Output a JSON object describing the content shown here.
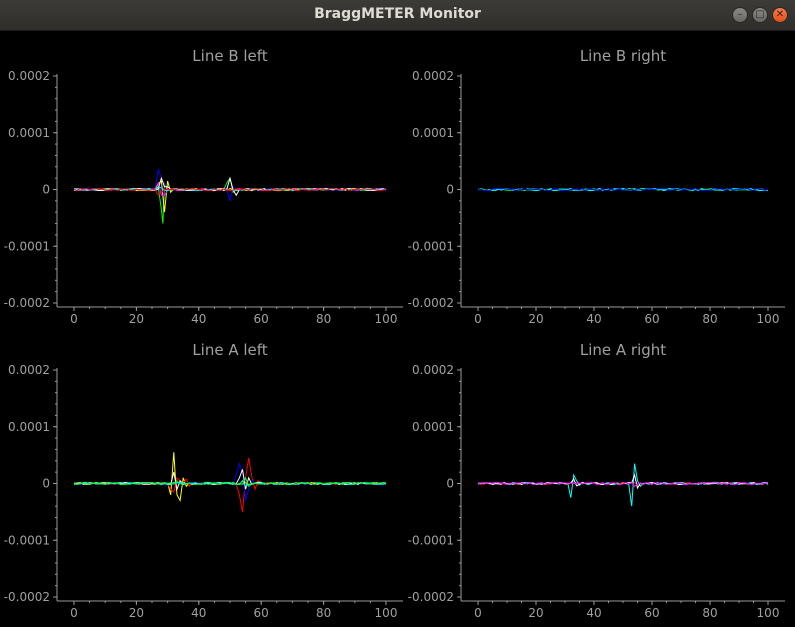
{
  "window": {
    "title": "BraggMETER Monitor",
    "buttons": [
      {
        "name": "minimize-button",
        "glyph": "–"
      },
      {
        "name": "maximize-button",
        "glyph": "□"
      },
      {
        "name": "close-button",
        "glyph": "✕"
      }
    ]
  },
  "colors": {
    "background": "#000000",
    "axis": "#9a9a9a",
    "text": "#a0a0a0"
  },
  "chart_data": [
    {
      "type": "line",
      "title": "Line B left",
      "xlim": [
        0,
        100
      ],
      "ylim": [
        -0.0002,
        0.0002
      ],
      "xticks": [
        "0",
        "20",
        "40",
        "60",
        "80",
        "100"
      ],
      "yticks": [
        "0.0002",
        "0.0001",
        "0",
        "-0.0001",
        "-0.0002"
      ],
      "series": [
        {
          "color": "#00ff00",
          "spikes": [
            [
              27,
              5e-06
            ],
            [
              28,
              -3.5e-05
            ],
            [
              28.5,
              -6e-05
            ],
            [
              29,
              1e-05
            ],
            [
              30,
              0
            ],
            [
              49,
              1.2e-05
            ],
            [
              50,
              2e-05
            ],
            [
              51,
              -5e-06
            ]
          ]
        },
        {
          "color": "#0000ff",
          "spikes": [
            [
              27,
              3.5e-05
            ],
            [
              28,
              2e-05
            ],
            [
              28.5,
              -2e-05
            ],
            [
              29,
              1e-05
            ],
            [
              50,
              -2e-05
            ],
            [
              51,
              5e-06
            ]
          ]
        },
        {
          "color": "#ffff00",
          "spikes": [
            [
              27,
              1e-05
            ],
            [
              28,
              1.5e-05
            ],
            [
              29,
              -4e-05
            ],
            [
              30,
              1.5e-05
            ],
            [
              31,
              -5e-06
            ]
          ]
        },
        {
          "color": "#ff00ff",
          "spikes": [
            [
              27,
              1.2e-05
            ],
            [
              28,
              -1e-05
            ],
            [
              29,
              -1e-05
            ]
          ]
        },
        {
          "color": "#ffffff",
          "spikes": [
            [
              28,
              2e-05
            ],
            [
              29,
              5e-06
            ],
            [
              30,
              5e-06
            ],
            [
              50,
              2e-05
            ],
            [
              52,
              -1e-05
            ],
            [
              53,
              0
            ]
          ]
        },
        {
          "color": "#00ffff",
          "spikes": [
            [
              27,
              4e-06
            ],
            [
              28,
              3e-06
            ]
          ]
        },
        {
          "color": "#ff0000",
          "spikes": [
            [
              27,
              -1e-05
            ],
            [
              28,
              -6e-06
            ]
          ]
        }
      ]
    },
    {
      "type": "line",
      "title": "Line B right",
      "xlim": [
        0,
        100
      ],
      "ylim": [
        -0.0002,
        0.0002
      ],
      "xticks": [
        "0",
        "20",
        "40",
        "60",
        "80",
        "100"
      ],
      "yticks": [
        "0.0002",
        "0.0001",
        "0",
        "-0.0001",
        "-0.0002"
      ],
      "series": [
        {
          "color": "#00ff00",
          "spikes": []
        },
        {
          "color": "#00ffff",
          "spikes": []
        },
        {
          "color": "#0000ff",
          "spikes": []
        }
      ]
    },
    {
      "type": "line",
      "title": "Line A left",
      "xlim": [
        0,
        100
      ],
      "ylim": [
        -0.0002,
        0.0002
      ],
      "xticks": [
        "0",
        "20",
        "40",
        "60",
        "80",
        "100"
      ],
      "yticks": [
        "0.0002",
        "0.0001",
        "0",
        "-0.0001",
        "-0.0002"
      ],
      "series": [
        {
          "color": "#ffff00",
          "spikes": [
            [
              31,
              -2e-05
            ],
            [
              32,
              5.5e-05
            ],
            [
              32.5,
              1e-05
            ],
            [
              33,
              -2e-05
            ],
            [
              34,
              -3e-05
            ],
            [
              35,
              1e-05
            ],
            [
              36,
              -5e-06
            ]
          ]
        },
        {
          "color": "#ff0000",
          "spikes": [
            [
              31,
              -1e-05
            ],
            [
              32,
              -1.5e-05
            ],
            [
              33,
              1e-05
            ],
            [
              34,
              5e-06
            ],
            [
              36,
              8e-06
            ],
            [
              37,
              -5e-06
            ],
            [
              53,
              -2e-05
            ],
            [
              54,
              -5e-05
            ],
            [
              55,
              1e-05
            ],
            [
              56,
              4.5e-05
            ],
            [
              57,
              1.2e-05
            ],
            [
              58,
              -1e-05
            ],
            [
              59,
              5e-06
            ]
          ]
        },
        {
          "color": "#0000ff",
          "spikes": [
            [
              52,
              1.5e-05
            ],
            [
              53,
              3.5e-05
            ],
            [
              54,
              2e-05
            ],
            [
              55,
              -3e-05
            ],
            [
              56,
              -1e-05
            ],
            [
              57,
              5e-06
            ]
          ]
        },
        {
          "color": "#ffffff",
          "spikes": [
            [
              32,
              2e-05
            ],
            [
              33,
              -1e-05
            ],
            [
              34,
              5e-06
            ],
            [
              53,
              1e-05
            ],
            [
              54,
              2.5e-05
            ],
            [
              55,
              -1e-05
            ],
            [
              56,
              1e-05
            ]
          ]
        },
        {
          "color": "#00ffff",
          "spikes": [
            [
              54,
              5e-06
            ],
            [
              55,
              -5e-06
            ]
          ]
        },
        {
          "color": "#00ff00",
          "spikes": [
            [
              33,
              5e-06
            ],
            [
              55,
              1e-05
            ],
            [
              56,
              -5e-06
            ]
          ]
        }
      ]
    },
    {
      "type": "line",
      "title": "Line A right",
      "xlim": [
        0,
        100
      ],
      "ylim": [
        -0.0002,
        0.0002
      ],
      "xticks": [
        "0",
        "20",
        "40",
        "60",
        "80",
        "100"
      ],
      "yticks": [
        "0.0002",
        "0.0001",
        "0",
        "-0.0001",
        "-0.0002"
      ],
      "series": [
        {
          "color": "#ff0000",
          "spikes": []
        },
        {
          "color": "#00ffff",
          "spikes": [
            [
              32,
              -2.5e-05
            ],
            [
              33,
              1.5e-05
            ],
            [
              34,
              5e-06
            ],
            [
              35,
              -3e-06
            ],
            [
              53,
              -4e-05
            ],
            [
              54,
              3.5e-05
            ],
            [
              55,
              5e-06
            ],
            [
              56,
              -5e-06
            ]
          ]
        },
        {
          "color": "#ffffff",
          "spikes": [
            [
              33,
              8e-06
            ],
            [
              34,
              -4e-06
            ],
            [
              54,
              1.5e-05
            ],
            [
              55,
              -8e-06
            ]
          ]
        },
        {
          "color": "#ff00ff",
          "spikes": [
            [
              54,
              -5e-06
            ]
          ]
        }
      ]
    }
  ]
}
